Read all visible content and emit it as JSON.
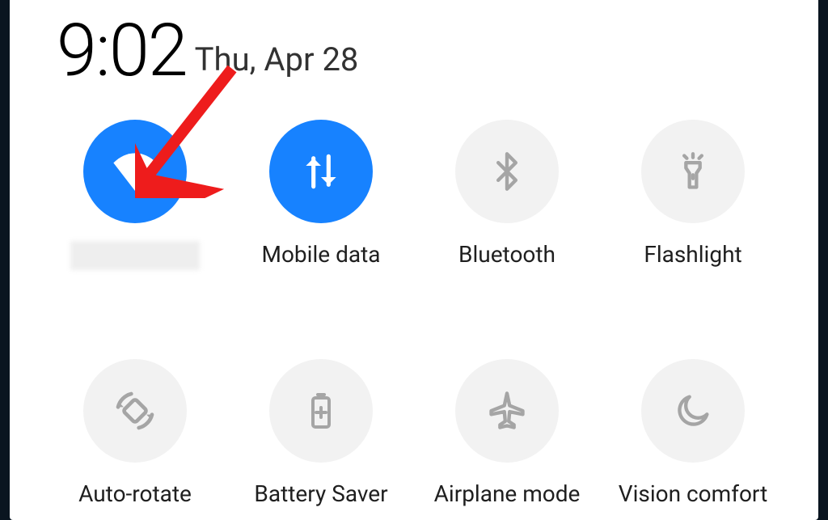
{
  "header": {
    "time": "9:02",
    "date": "Thu, Apr 28"
  },
  "tiles": {
    "wifi": {
      "label": "",
      "active": true
    },
    "mobile_data": {
      "label": "Mobile data",
      "active": true
    },
    "bluetooth": {
      "label": "Bluetooth",
      "active": false
    },
    "flashlight": {
      "label": "Flashlight",
      "active": false
    },
    "auto_rotate": {
      "label": "Auto-rotate",
      "active": false
    },
    "battery_saver": {
      "label": "Battery Saver",
      "active": false
    },
    "airplane_mode": {
      "label": "Airplane mode",
      "active": false
    },
    "vision_comfort": {
      "label": "Vision comfort",
      "active": false
    }
  },
  "colors": {
    "accent_active": "#1782ff",
    "tile_inactive": "#f2f2f2",
    "icon_inactive": "#a5a5a5",
    "icon_active": "#ffffff",
    "annotation": "#ee1c1c"
  },
  "annotation": {
    "target": "wifi"
  }
}
